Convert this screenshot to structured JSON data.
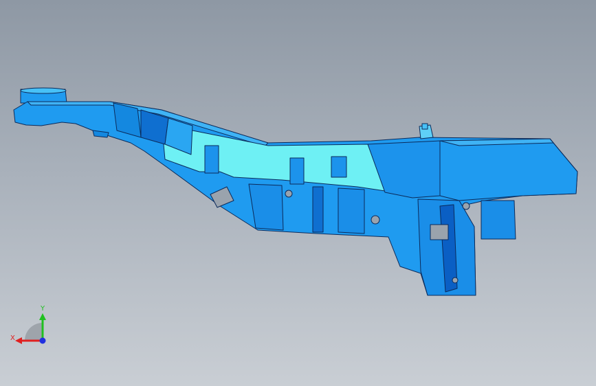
{
  "viewport": {
    "background_top": "#8e98a4",
    "background_bottom": "#c9ced4"
  },
  "model": {
    "primary_color": "#1f9bf0",
    "light_face_color": "#6ef0f4",
    "dark_face_color": "#0a5fc4",
    "edge_color": "#0b2a5a"
  },
  "triad": {
    "x_label": "X",
    "y_label": "Y",
    "x_color": "#e02020",
    "y_color": "#20c020",
    "z_color": "#2030e0"
  }
}
